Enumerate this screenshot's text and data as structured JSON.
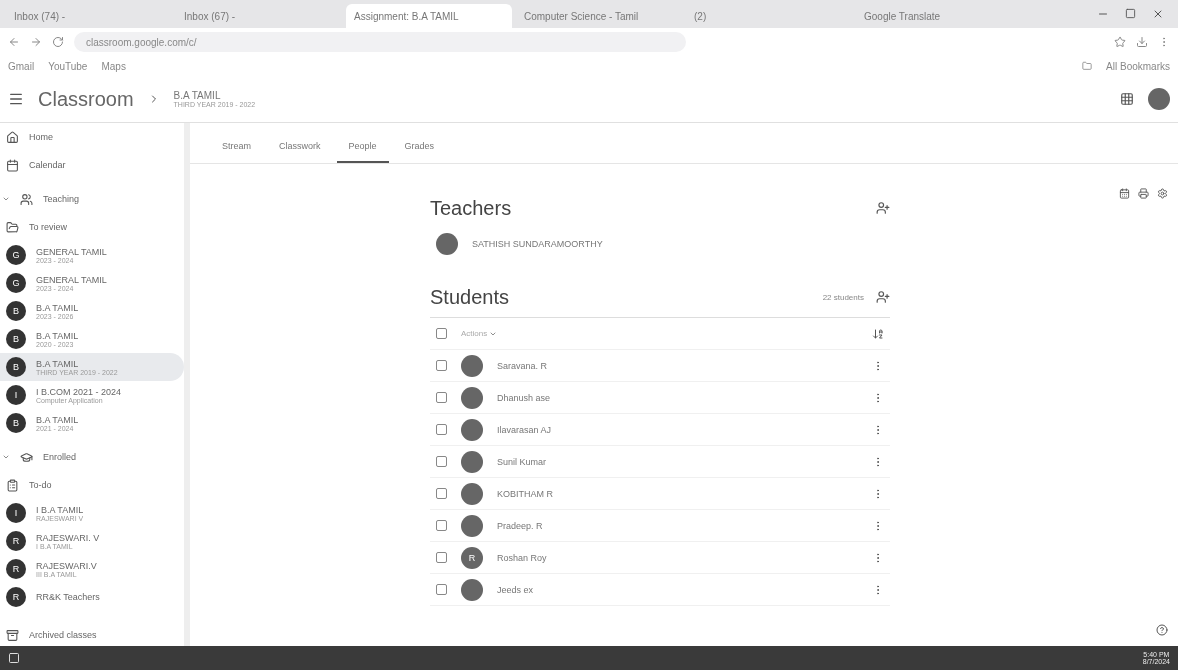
{
  "browser": {
    "tabs": [
      {
        "title": "Inbox (74) - ",
        "selected": false
      },
      {
        "title": "Inbox (67) - ",
        "selected": false
      },
      {
        "title": "Assignment: B.A TAMIL",
        "selected": true
      },
      {
        "title": "Computer Science - Tamil",
        "selected": false
      },
      {
        "title": "(2) ",
        "selected": false
      },
      {
        "title": "Google Translate",
        "selected": false
      }
    ],
    "url": "classroom.google.com/c/",
    "bookmarks": [
      "Gmail",
      "YouTube",
      "Maps"
    ],
    "all_bookmarks": "All Bookmarks"
  },
  "header": {
    "app": "Classroom",
    "class_title": "B.A TAMIL",
    "class_subtitle": "THIRD YEAR 2019 - 2022"
  },
  "sidebar": {
    "items": [
      {
        "kind": "nav",
        "label": "Home",
        "selected": false
      },
      {
        "kind": "nav",
        "label": "Calendar",
        "selected": false
      },
      {
        "kind": "section",
        "label": "Teaching",
        "expanded": true
      },
      {
        "kind": "nav",
        "label": "To review",
        "selected": false
      },
      {
        "kind": "class",
        "letter": "G",
        "label": "GENERAL TAMIL",
        "subtitle": "2023 - 2024",
        "selected": false
      },
      {
        "kind": "class",
        "letter": "G",
        "label": "GENERAL TAMIL",
        "subtitle": "2023 - 2024",
        "selected": false
      },
      {
        "kind": "class",
        "letter": "B",
        "label": "B.A TAMIL",
        "subtitle": "2023 - 2026",
        "selected": false
      },
      {
        "kind": "class",
        "letter": "B",
        "label": "B.A TAMIL",
        "subtitle": "2020 - 2023",
        "selected": false
      },
      {
        "kind": "class",
        "letter": "B",
        "label": "B.A TAMIL",
        "subtitle": "THIRD YEAR 2019 - 2022",
        "selected": true
      },
      {
        "kind": "class",
        "letter": "I",
        "label": "I B.COM 2021 - 2024",
        "subtitle": "Computer Application",
        "selected": false
      },
      {
        "kind": "class",
        "letter": "B",
        "label": "B.A TAMIL",
        "subtitle": "2021 - 2024",
        "selected": false
      },
      {
        "kind": "section",
        "label": "Enrolled",
        "expanded": true
      },
      {
        "kind": "nav",
        "label": "To-do",
        "selected": false
      },
      {
        "kind": "class",
        "letter": "I",
        "label": "I B.A TAMIL",
        "subtitle": "RAJESWARI V",
        "selected": false
      },
      {
        "kind": "class",
        "letter": "R",
        "label": "RAJESWARI. V",
        "subtitle": "I B.A TAMIL",
        "selected": false
      },
      {
        "kind": "class",
        "letter": "R",
        "label": "RAJESWARI.V",
        "subtitle": "III B.A TAMIL",
        "selected": false
      },
      {
        "kind": "class",
        "letter": "R",
        "label": "RR&K Teachers",
        "selected": false
      },
      {
        "kind": "nav",
        "label": "Archived classes",
        "selected": false
      }
    ]
  },
  "tabs": [
    {
      "label": "Stream",
      "selected": false
    },
    {
      "label": "Classwork",
      "selected": false
    },
    {
      "label": "People",
      "selected": true
    },
    {
      "label": "Grades",
      "selected": false
    }
  ],
  "teachers": {
    "title": "Teachers",
    "list": [
      "SATHISH SUNDARAMOORTHY"
    ]
  },
  "students": {
    "title": "Students",
    "count": "22 students",
    "actions": "Actions",
    "all_checked": false,
    "list": [
      {
        "name": "Saravana. R",
        "checked": false
      },
      {
        "name": "Dhanush ase",
        "checked": false
      },
      {
        "name": "Ilavarasan AJ",
        "checked": false
      },
      {
        "name": "Sunil Kumar",
        "checked": false
      },
      {
        "name": "KOBITHAM R",
        "checked": false
      },
      {
        "name": "Pradeep. R",
        "checked": false
      },
      {
        "name": "Roshan Roy",
        "letter": "R",
        "checked": false
      },
      {
        "name": "Jeeds ex",
        "checked": false
      }
    ]
  },
  "taskbar": {
    "time": "5:40 PM",
    "date": "8/7/2024"
  }
}
